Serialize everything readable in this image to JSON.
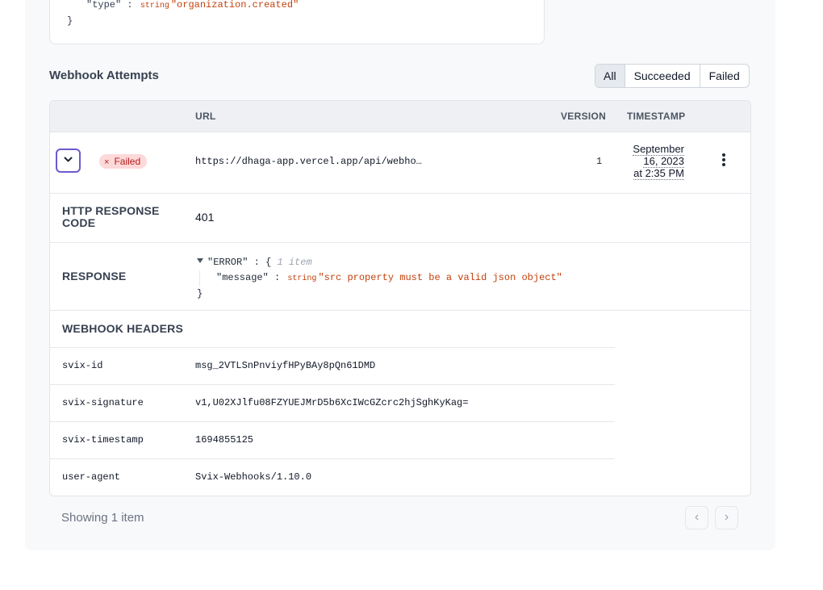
{
  "payload_snippet": {
    "key": "\"type\"",
    "colon": ":",
    "type_label": "string",
    "value": "\"organization.created\"",
    "close_brace": "}"
  },
  "attempts": {
    "title": "Webhook Attempts",
    "filters": [
      "All",
      "Succeeded",
      "Failed"
    ],
    "selected_filter": "All",
    "columns": {
      "url": "URL",
      "version": "VERSION",
      "timestamp": "TIMESTAMP"
    },
    "row": {
      "status": "Failed",
      "status_icon": "×",
      "url": "https://dhaga-app.vercel.app/api/webho…",
      "version": "1",
      "timestamp_lines": [
        "September",
        "16, 2023",
        "at 2:35 PM"
      ]
    },
    "details": {
      "http_code_label_line1": "HTTP RESPONSE",
      "http_code_label_line2": "CODE",
      "http_code": "401",
      "response_label": "RESPONSE",
      "response_json": {
        "key": "\"ERROR\"",
        "colon": ":",
        "open": "{",
        "count": "1 item",
        "inner_key": "\"message\"",
        "inner_colon": ":",
        "inner_type": "string",
        "inner_value": "\"src property must be a valid json object\"",
        "close": "}"
      },
      "headers_label": "WEBHOOK HEADERS",
      "headers": [
        {
          "key": "svix-id",
          "value": "msg_2VTLSnPnviyfHPyBAy8pQn61DMD"
        },
        {
          "key": "svix-signature",
          "value": "v1,U02XJlfu08FZYUEJMrD5b6XcIWcGZcrc2hjSghKyKag="
        },
        {
          "key": "svix-timestamp",
          "value": "1694855125"
        },
        {
          "key": "user-agent",
          "value": "Svix-Webhooks/1.10.0"
        }
      ]
    },
    "footer": "Showing 1 item",
    "pagination": {
      "prev": "‹",
      "next": "›"
    }
  },
  "colors": {
    "accent": "#6d5acf",
    "failed_bg": "#fdd9d9",
    "failed_text": "#b91c1c",
    "json_string": "#c2410c"
  }
}
